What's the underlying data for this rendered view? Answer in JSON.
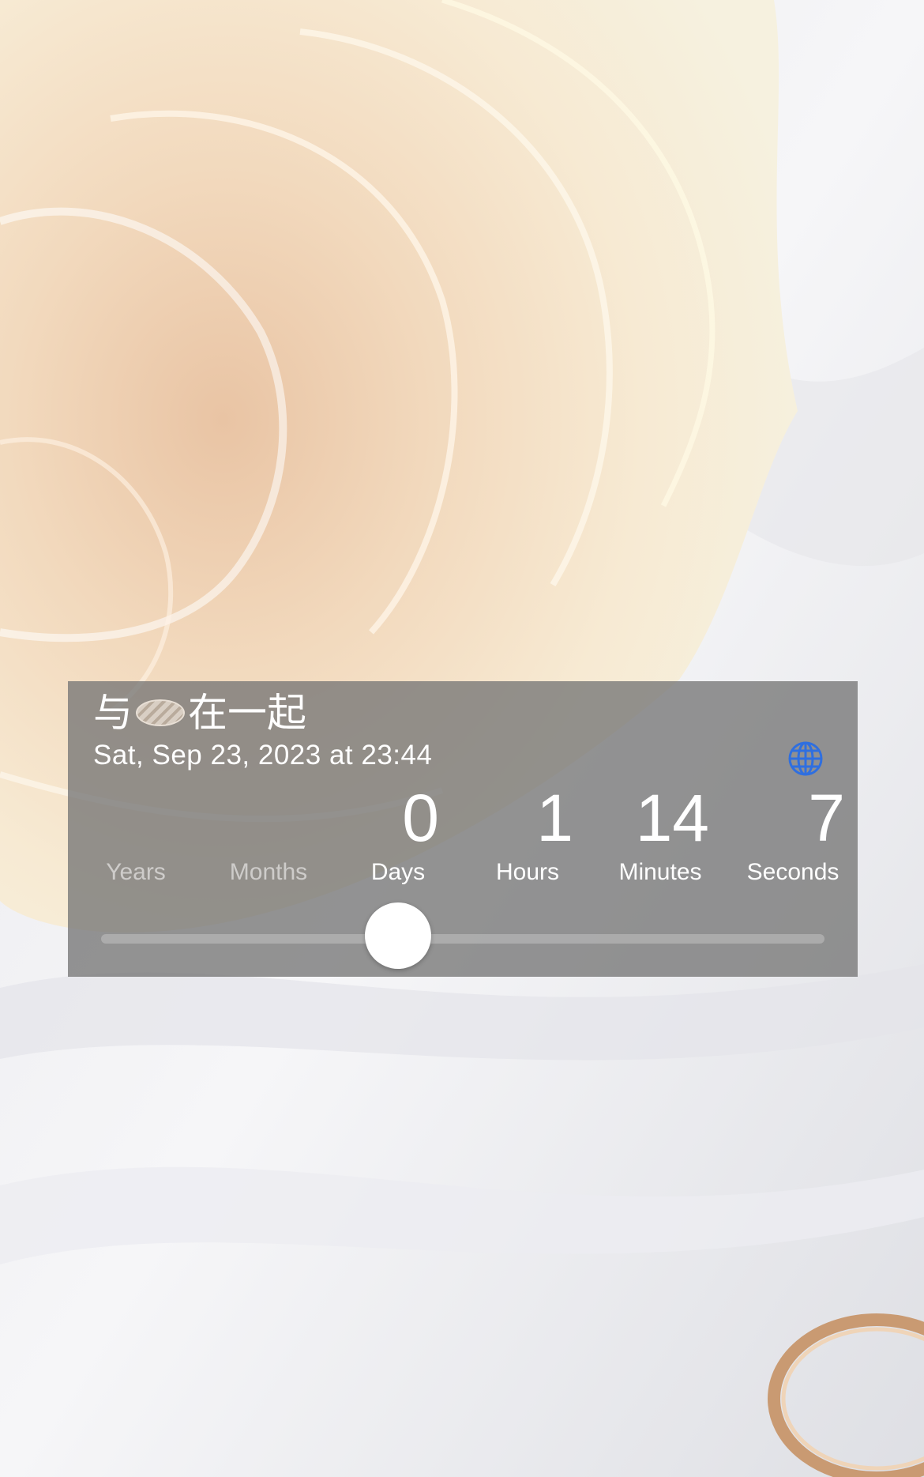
{
  "title": {
    "prefix": "与",
    "suffix": "在一起"
  },
  "date_text": "Sat, Sep 23, 2023 at 23:44",
  "units": [
    {
      "label": "Years",
      "value": ""
    },
    {
      "label": "Months",
      "value": ""
    },
    {
      "label": "Days",
      "value": "0"
    },
    {
      "label": "Hours",
      "value": "1"
    },
    {
      "label": "Minutes",
      "value": "14"
    },
    {
      "label": "Seconds",
      "value": "7"
    }
  ],
  "slider": {
    "selected_unit": "Days",
    "position_fraction": 0.41
  },
  "icons": {
    "globe": "globe-icon"
  },
  "colors": {
    "card_overlay": "#767676",
    "globe_blue": "#2f6fe0",
    "text": "#ffffff"
  }
}
